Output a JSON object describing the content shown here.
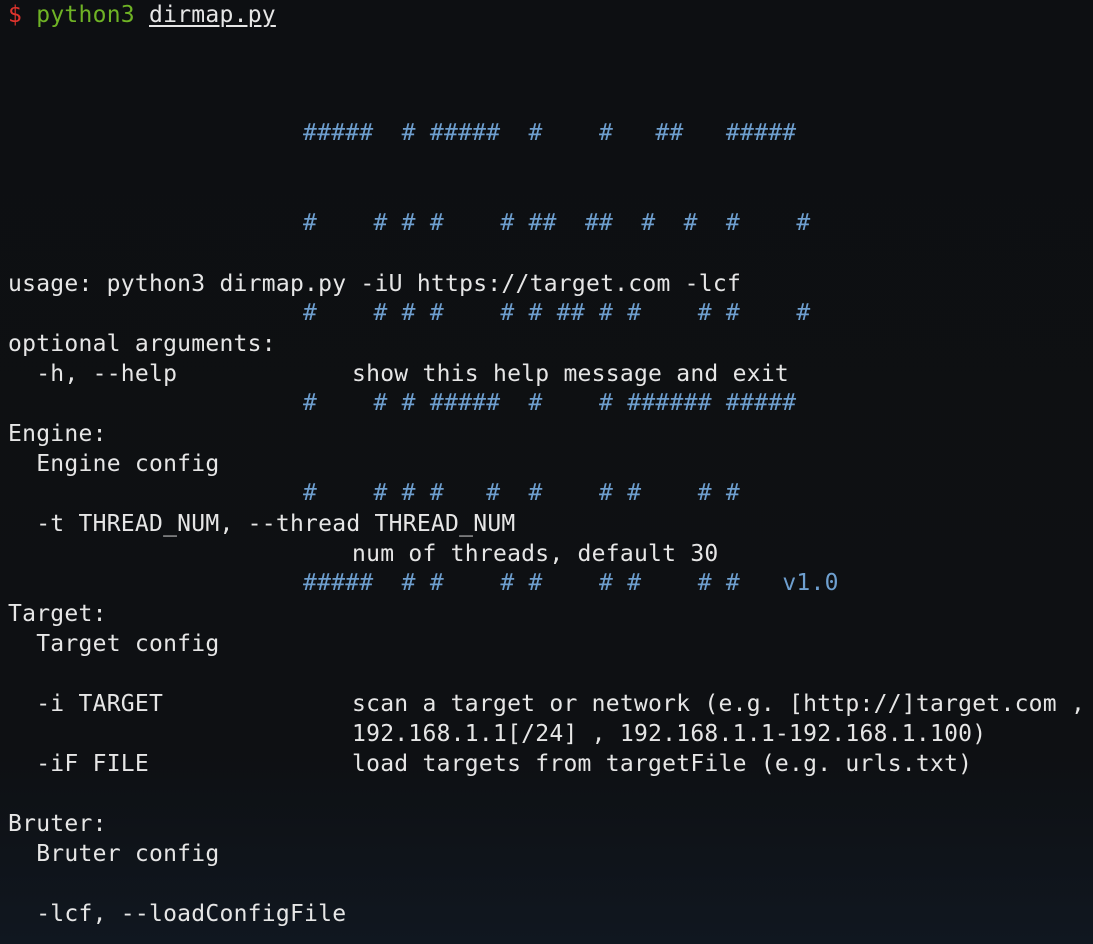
{
  "prompt": {
    "symbol": "$",
    "command": "python3",
    "argument": "dirmap.py"
  },
  "banner": {
    "ascii_lines": [
      "#####  # #####  #    #   ##   #####",
      "#    # # #    # ##  ##  #  #  #    #",
      "#    # # #    # # ## # #    # #    #",
      "#    # # #####  #    # ###### #####",
      "#    # # #   #  #    # #    # #",
      "#####  # #    # #    # #    # #"
    ],
    "version": "v1.0"
  },
  "usage": "usage: python3 dirmap.py -iU https://target.com -lcf",
  "sections": {
    "optional": {
      "heading": "optional arguments:",
      "help_flag": "-h, --help",
      "help_desc": "show this help message and exit"
    },
    "engine": {
      "heading": "Engine:",
      "subheading": "Engine config",
      "thread_flag": "-t THREAD_NUM, --thread THREAD_NUM",
      "thread_desc": "num of threads, default 30"
    },
    "target": {
      "heading": "Target:",
      "subheading": "Target config",
      "i_flag": "-i TARGET",
      "i_desc_1": "scan a target or network (e.g. [http://]target.com ,",
      "i_desc_2": "192.168.1.1[/24] , 192.168.1.1-192.168.1.100)",
      "if_flag": "-iF FILE",
      "if_desc": "load targets from targetFile (e.g. urls.txt)"
    },
    "bruter": {
      "heading": "Bruter:",
      "subheading": "Bruter config",
      "lcf_flag": "-lcf, --loadConfigFile"
    }
  },
  "colors": {
    "prompt_symbol": "#e0342d",
    "prompt_command": "#6fb325",
    "banner": "#6e9fcf",
    "text": "#e6e6e6",
    "background": "#0e1013"
  }
}
